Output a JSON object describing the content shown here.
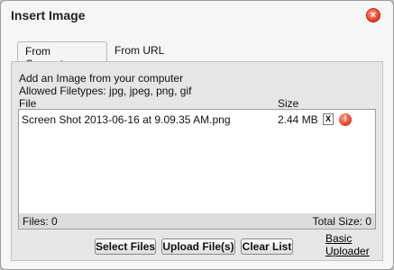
{
  "dialog": {
    "title": "Insert Image",
    "close_icon": "close-icon",
    "close_glyph": "×"
  },
  "tabs": [
    {
      "label": "From Computer",
      "active": true
    },
    {
      "label": "From URL",
      "active": false
    }
  ],
  "panel": {
    "line1": "Add an Image from your computer",
    "line2": "Allowed Filetypes: jpg, jpeg, png, gif",
    "col_file": "File",
    "col_size": "Size"
  },
  "files": [
    {
      "name": "Screen Shot 2013-06-16 at 9.09.35 AM.png",
      "size": "2.44 MB",
      "remove_label": "X",
      "status_icon": "error-icon",
      "status_glyph": "!"
    }
  ],
  "footer": {
    "files_count": "Files: 0",
    "total_size": "Total Size: 0"
  },
  "buttons": {
    "select_files": "Select Files",
    "upload_files": "Upload File(s)",
    "clear_list": "Clear List"
  },
  "basic_uploader": {
    "line1": "Basic",
    "line2": "Uploader"
  },
  "colors": {
    "close_red": "#f04b2c",
    "panel_bg": "#e6e6e6",
    "dialog_bg": "#f6f6f6"
  }
}
